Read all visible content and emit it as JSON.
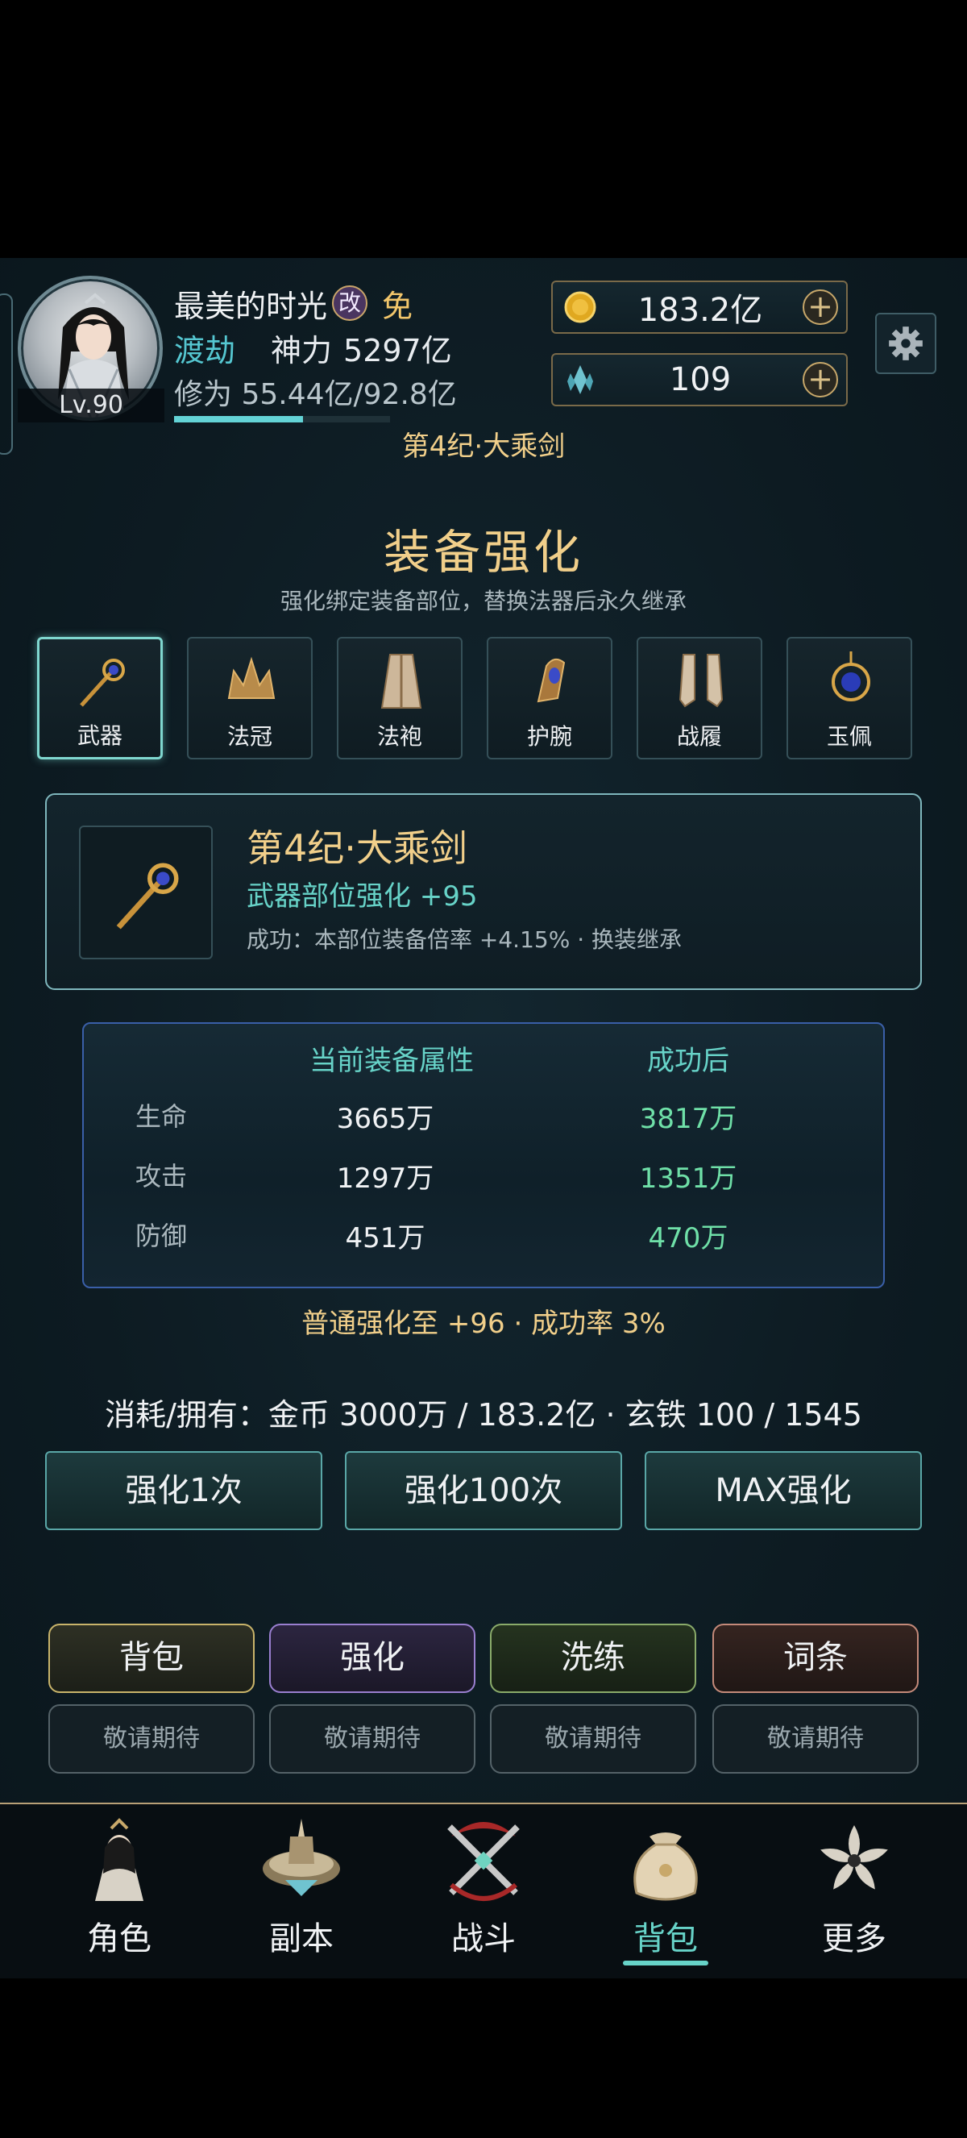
{
  "player": {
    "name": "最美的时光",
    "badge_gai": "改",
    "badge_mian": "免",
    "level": "Lv.90",
    "realm": "渡劫",
    "power_label": "神力",
    "power_value": "5297亿",
    "xiuwei": "修为 55.44亿/92.8亿",
    "xp_progress": 0.597,
    "era_title": "第4纪·大乘剑"
  },
  "resources": {
    "gold": "183.2亿",
    "crystal": "109",
    "gold_icon": "gold-coin-icon",
    "crystal_icon": "crystal-icon"
  },
  "header": {
    "title": "装备强化",
    "subtitle": "强化绑定装备部位，替换法器后永久继承"
  },
  "slots": [
    {
      "label": "武器",
      "icon": "staff-icon",
      "active": true
    },
    {
      "label": "法冠",
      "icon": "crown-icon",
      "active": false
    },
    {
      "label": "法袍",
      "icon": "robe-icon",
      "active": false
    },
    {
      "label": "护腕",
      "icon": "bracer-icon",
      "active": false
    },
    {
      "label": "战履",
      "icon": "boots-icon",
      "active": false
    },
    {
      "label": "玉佩",
      "icon": "pendant-icon",
      "active": false
    }
  ],
  "selected": {
    "name": "第4纪·大乘剑",
    "enhance": "武器部位强化 +95",
    "desc": "成功：本部位装备倍率 +4.15% · 换装继承"
  },
  "stats": {
    "col_current": "当前装备属性",
    "col_after": "成功后",
    "rows": [
      {
        "label": "生命",
        "current": "3665万",
        "after": "3817万"
      },
      {
        "label": "攻击",
        "current": "1297万",
        "after": "1351万"
      },
      {
        "label": "防御",
        "current": "451万",
        "after": "470万"
      }
    ]
  },
  "enhance_info": "普通强化至 +96 · 成功率 3%",
  "cost_line": "消耗/拥有：金币 3000万 / 183.2亿 · 玄铁 100 / 1545",
  "actions": {
    "once": "强化1次",
    "hundred": "强化100次",
    "max": "MAX强化"
  },
  "bag_tabs": [
    {
      "label": "背包",
      "sub": "敬请期待",
      "color": "#c9b46a"
    },
    {
      "label": "强化",
      "sub": "敬请期待",
      "color": "#9a7fd0"
    },
    {
      "label": "洗练",
      "sub": "敬请期待",
      "color": "#8aab6a"
    },
    {
      "label": "词条",
      "sub": "敬请期待",
      "color": "#c48a7a"
    }
  ],
  "nav": [
    {
      "label": "角色",
      "icon": "character-icon",
      "active": false
    },
    {
      "label": "副本",
      "icon": "dungeon-icon",
      "active": false
    },
    {
      "label": "战斗",
      "icon": "battle-icon",
      "active": false
    },
    {
      "label": "背包",
      "icon": "bag-icon",
      "active": true
    },
    {
      "label": "更多",
      "icon": "more-icon",
      "active": false
    }
  ],
  "colors": {
    "accent_teal": "#67d3c8",
    "gold_text": "#f1cf8a",
    "success_green": "#6fe0a8"
  }
}
